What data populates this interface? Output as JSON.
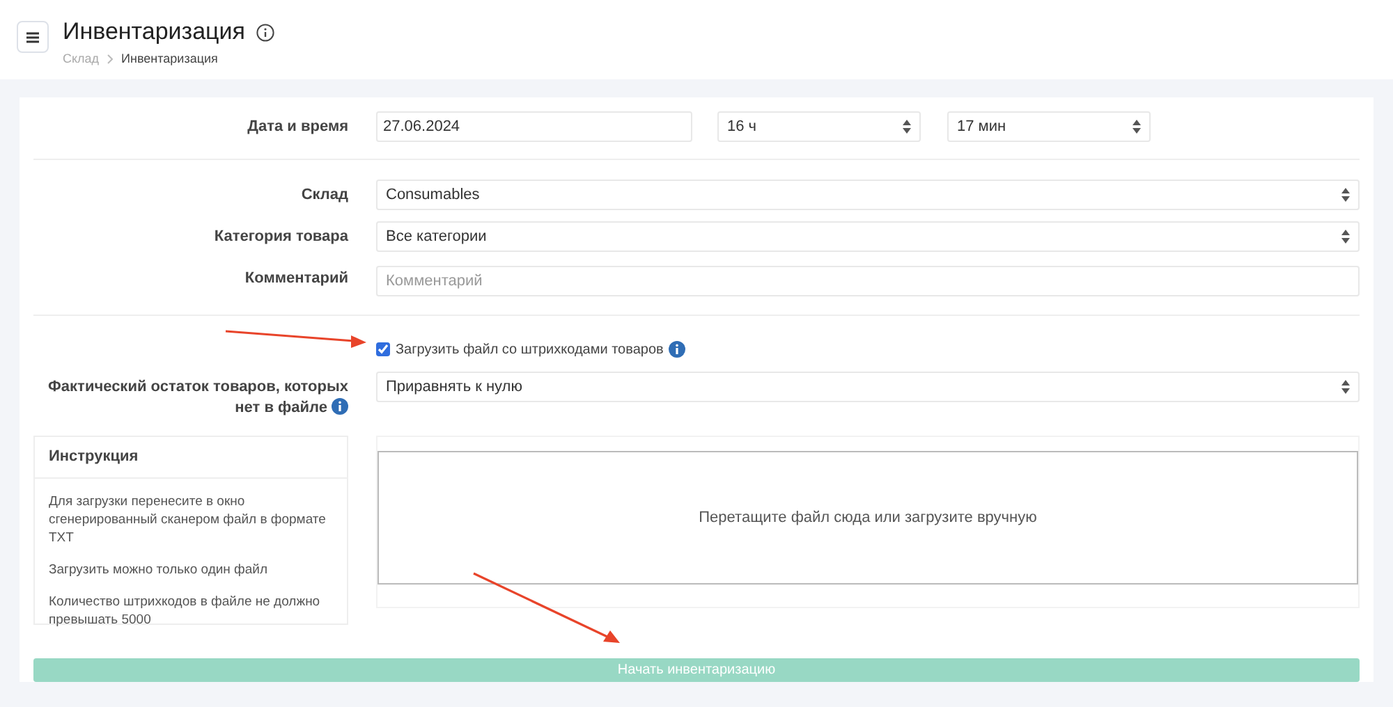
{
  "header": {
    "title": "Инвентаризация",
    "breadcrumbs": [
      {
        "label": "Склад",
        "current": false
      },
      {
        "label": "Инвентаризация",
        "current": true
      }
    ]
  },
  "form": {
    "date_row": {
      "label": "Дата и время",
      "date": "27.06.2024",
      "hour": "16 ч",
      "minute": "17 мин"
    },
    "fields": [
      {
        "label": "Склад",
        "kind": "select",
        "value": "Consumables"
      },
      {
        "label": "Категория товара",
        "kind": "select",
        "value": "Все категории"
      },
      {
        "label": "Комментарий",
        "kind": "input",
        "placeholder": "Комментарий"
      }
    ],
    "upload_checkbox": {
      "label": "Загрузить файл со штрихкодами товаров",
      "checked": true
    },
    "missing_row": {
      "label": "Фактический остаток товаров, которых нет в файле",
      "value": "Приравнять к нулю"
    },
    "instructions": {
      "title": "Инструкция",
      "items": [
        "Для загрузки перенесите в окно сгенерированный сканером файл в формате TXT",
        "Загрузить можно только один файл",
        "Количество штрихкодов в файле не должно превышать 5000"
      ]
    },
    "dropzone": {
      "text": "Перетащите файл сюда или загрузите вручную"
    },
    "submit": {
      "label": "Начать инвентаризацию",
      "disabled": true
    }
  }
}
